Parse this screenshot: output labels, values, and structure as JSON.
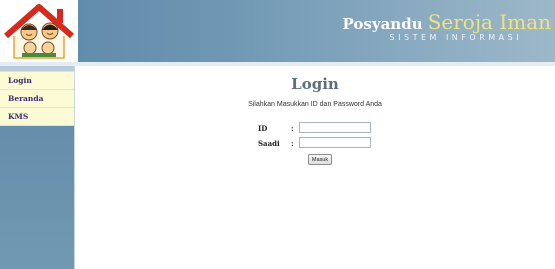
{
  "header": {
    "brand_name": "Posyandu",
    "brand_accent": "Seroja Iman",
    "brand_subtitle": "SISTEM INFORMASI"
  },
  "sidebar": {
    "items": [
      {
        "label": "Login"
      },
      {
        "label": "Beranda"
      },
      {
        "label": "KMS"
      }
    ]
  },
  "main": {
    "title": "Login",
    "instruction": "Silahkan Masukkan ID dan Password Anda",
    "form": {
      "id_label": "ID",
      "id_colon": ":",
      "id_value": "",
      "password_label": "Saadi",
      "password_colon": ":",
      "password_value": "",
      "submit_label": "Masuk"
    }
  },
  "colors": {
    "header": "#6f97b3",
    "brand_accent": "#f2e37a",
    "menu_bg": "#fdfbd6",
    "menu_text": "#3a2a72",
    "title": "#5c6f80"
  }
}
